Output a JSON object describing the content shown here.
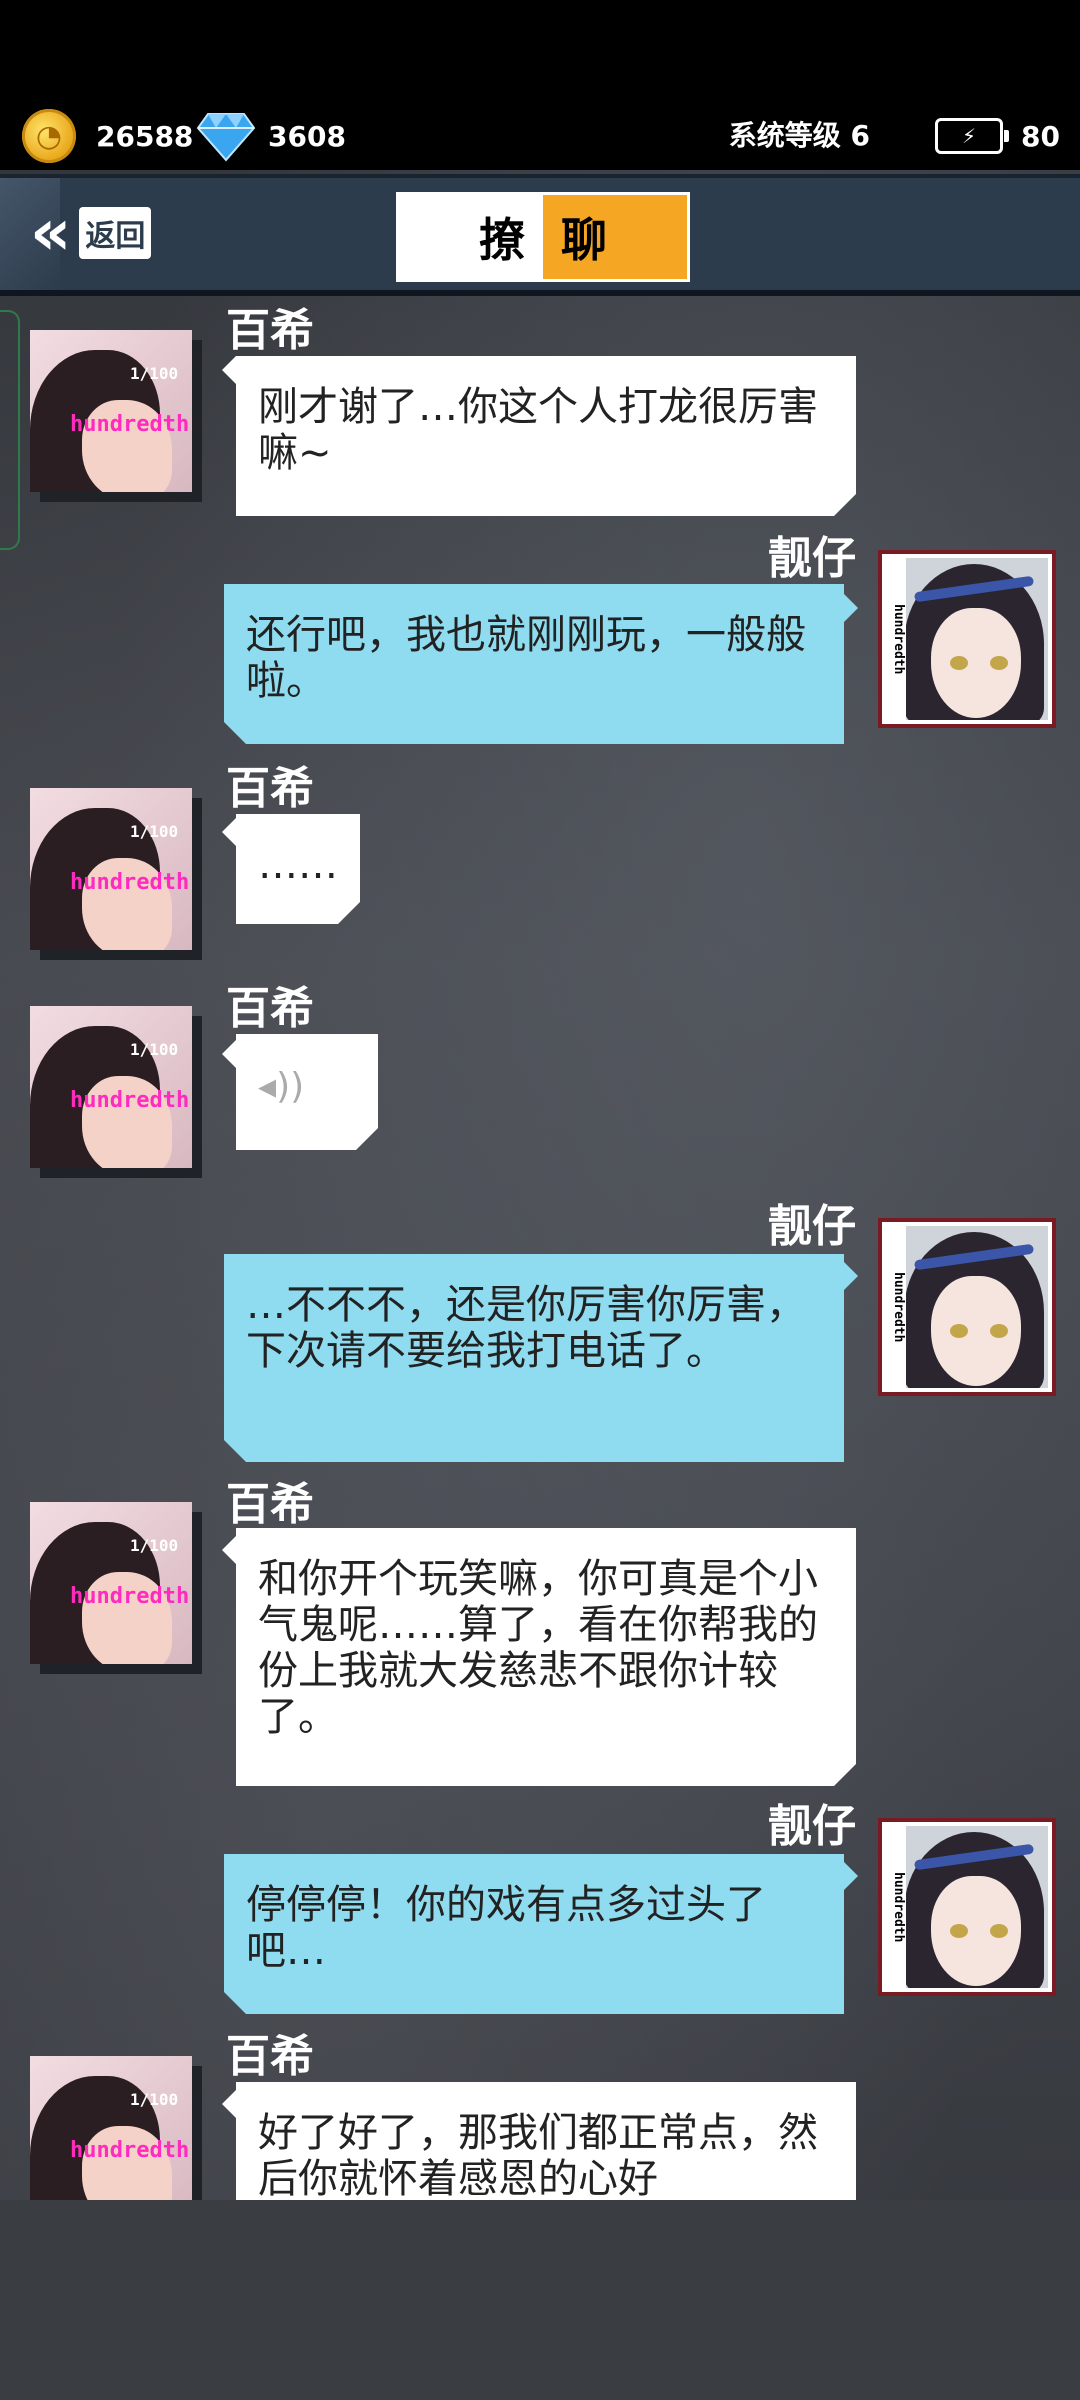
{
  "status": {
    "coins": "26588",
    "gems": "3608",
    "system_level": "系统等级 6",
    "energy": "80",
    "coin_icon": "coin-icon",
    "gem_icon": "diamond-icon",
    "energy_icon": "battery-bolt-icon"
  },
  "nav": {
    "back_label": "返回",
    "title_left": "撩",
    "title_right": "聊",
    "accent_color": "#f5a623"
  },
  "avatars": {
    "left_tag": "hundredth",
    "left_tag2": "1/100",
    "right_tag": "hundredth"
  },
  "messages": [
    {
      "speaker": "百希",
      "side": "left",
      "text": "刚才谢了…你这个人打龙很厉害嘛~"
    },
    {
      "speaker": "靓仔",
      "side": "right",
      "text": "还行吧，我也就刚刚玩，一般般啦。"
    },
    {
      "speaker": "百希",
      "side": "left",
      "text": "……"
    },
    {
      "speaker": "百希",
      "side": "left",
      "text": "voice"
    },
    {
      "speaker": "靓仔",
      "side": "right",
      "text": "…不不不，还是你厉害你厉害，下次请不要给我打电话了。"
    },
    {
      "speaker": "百希",
      "side": "left",
      "text": "和你开个玩笑嘛，你可真是个小气鬼呢……算了，看在你帮我的份上我就大发慈悲不跟你计较了。"
    },
    {
      "speaker": "靓仔",
      "side": "right",
      "text": "停停停！你的戏有点多过头了吧…"
    },
    {
      "speaker": "百希",
      "side": "left",
      "text": "好了好了，那我们都正常点，然后你就怀着感恩的心好"
    }
  ]
}
